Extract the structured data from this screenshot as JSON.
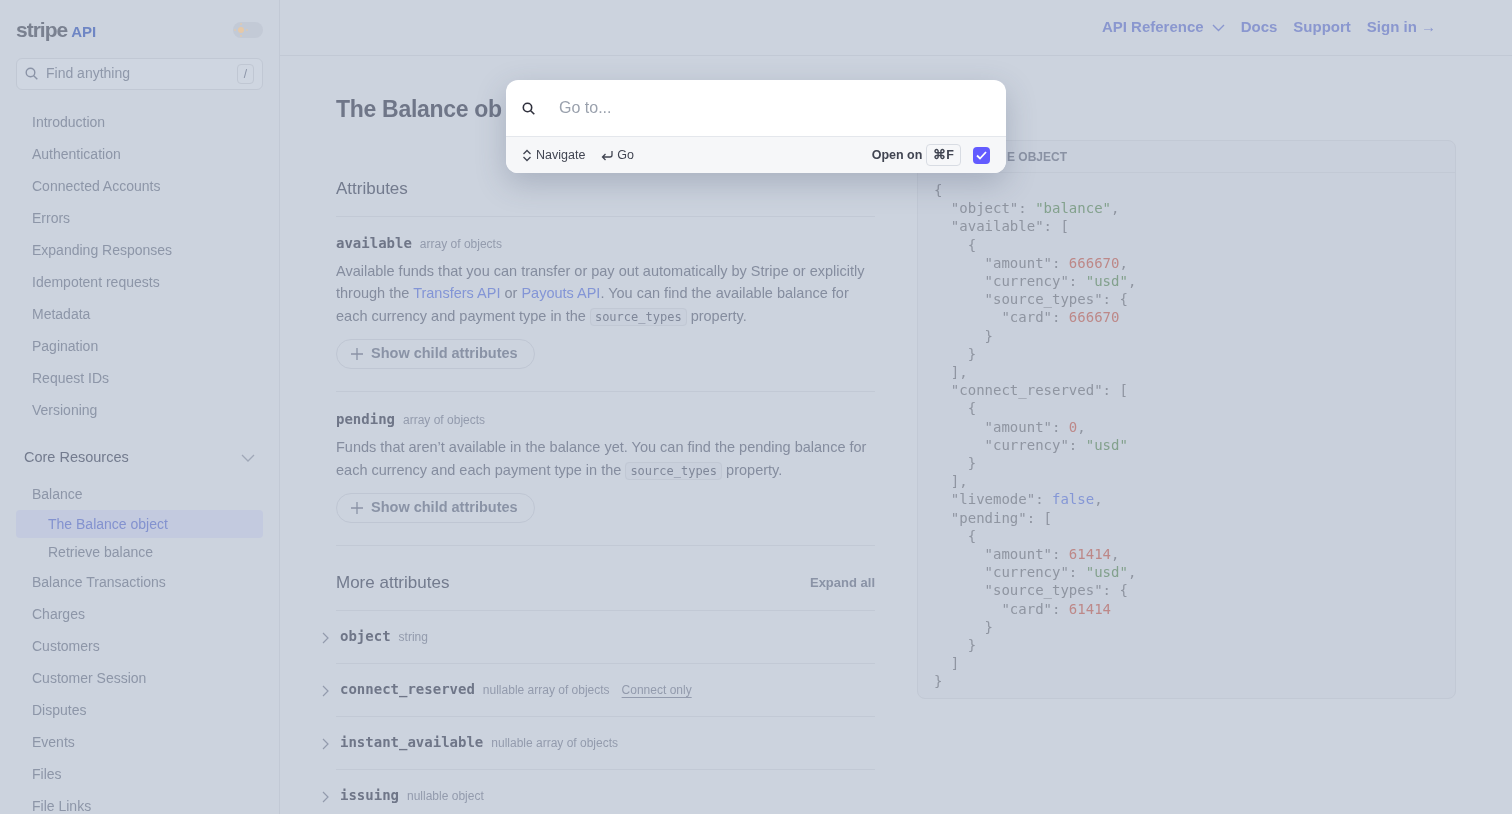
{
  "sidebar": {
    "logo": {
      "wordmark": "stripe",
      "tag": "API"
    },
    "theme_toggle": {
      "dark": false
    },
    "search": {
      "placeholder": "Find anything",
      "shortcut": "/"
    },
    "items": [
      {
        "label": "Introduction"
      },
      {
        "label": "Authentication"
      },
      {
        "label": "Connected Accounts"
      },
      {
        "label": "Errors"
      },
      {
        "label": "Expanding Responses"
      },
      {
        "label": "Idempotent requests"
      },
      {
        "label": "Metadata"
      },
      {
        "label": "Pagination"
      },
      {
        "label": "Request IDs"
      },
      {
        "label": "Versioning"
      }
    ],
    "section": {
      "title": "Core Resources",
      "expanded": true,
      "items": [
        {
          "label": "Balance",
          "selected": false,
          "children": [
            {
              "label": "The Balance object",
              "selected": true
            },
            {
              "label": "Retrieve balance",
              "selected": false
            }
          ]
        },
        {
          "label": "Balance Transactions",
          "selected": false
        },
        {
          "label": "Charges",
          "selected": false
        },
        {
          "label": "Customers",
          "selected": false
        },
        {
          "label": "Customer Session",
          "selected": false
        },
        {
          "label": "Disputes",
          "selected": false
        },
        {
          "label": "Events",
          "selected": false
        },
        {
          "label": "Files",
          "selected": false
        },
        {
          "label": "File Links",
          "selected": false
        }
      ]
    }
  },
  "topnav": [
    {
      "label": "API Reference",
      "kind": "dropdown"
    },
    {
      "label": "Docs",
      "kind": "link"
    },
    {
      "label": "Support",
      "kind": "link"
    },
    {
      "label": "Sign in →",
      "kind": "link"
    }
  ],
  "title": "The Balance ob",
  "attributes": {
    "heading": "Attributes",
    "items": [
      {
        "name": "available",
        "type": "array of objects",
        "description": [
          {
            "kind": "text",
            "text": "Available funds that you can transfer or pay out automatically by Stripe or explicitly through the "
          },
          {
            "kind": "link",
            "text": "Transfers API"
          },
          {
            "kind": "text",
            "text": " or "
          },
          {
            "kind": "link",
            "text": "Payouts API"
          },
          {
            "kind": "text",
            "text": ". You can find the available balance for each currency and payment type in the "
          },
          {
            "kind": "code",
            "text": "source_types"
          },
          {
            "kind": "text",
            "text": " property."
          }
        ],
        "button": "Show child attributes"
      },
      {
        "name": "pending",
        "type": "array of objects",
        "description": [
          {
            "kind": "text",
            "text": "Funds that aren’t available in the balance yet. You can find the pending balance for each currency and each payment type in the "
          },
          {
            "kind": "code",
            "text": "source_types"
          },
          {
            "kind": "text",
            "text": " property."
          }
        ],
        "button": "Show child attributes"
      }
    ]
  },
  "more_attributes": {
    "heading": "More attributes",
    "expand": "Expand all",
    "items": [
      {
        "name": "object",
        "type": "string"
      },
      {
        "name": "connect_reserved",
        "type": "nullable array of objects",
        "tag": "Connect only"
      },
      {
        "name": "instant_available",
        "type": "nullable array of objects"
      },
      {
        "name": "issuing",
        "type": "nullable object"
      }
    ]
  },
  "code_panel": {
    "header": "E OBJECT",
    "lines": [
      "{",
      "  \"object\": \"balance\",",
      "  \"available\": [",
      "    {",
      "      \"amount\": 666670,",
      "      \"currency\": \"usd\",",
      "      \"source_types\": {",
      "        \"card\": 666670",
      "      }",
      "    }",
      "  ],",
      "  \"connect_reserved\": [",
      "    {",
      "      \"amount\": 0,",
      "      \"currency\": \"usd\"",
      "    }",
      "  ],",
      "  \"livemode\": false,",
      "  \"pending\": [",
      "    {",
      "      \"amount\": 61414,",
      "      \"currency\": \"usd\",",
      "      \"source_types\": {",
      "        \"card\": 61414",
      "      }",
      "    }",
      "  ]",
      "}"
    ]
  },
  "modal": {
    "placeholder": "Go to...",
    "hints": [
      {
        "kind": "updown",
        "label": "Navigate"
      },
      {
        "kind": "enter",
        "label": "Go"
      }
    ],
    "open_on": "Open on",
    "key": "⌘F",
    "checked": true
  }
}
